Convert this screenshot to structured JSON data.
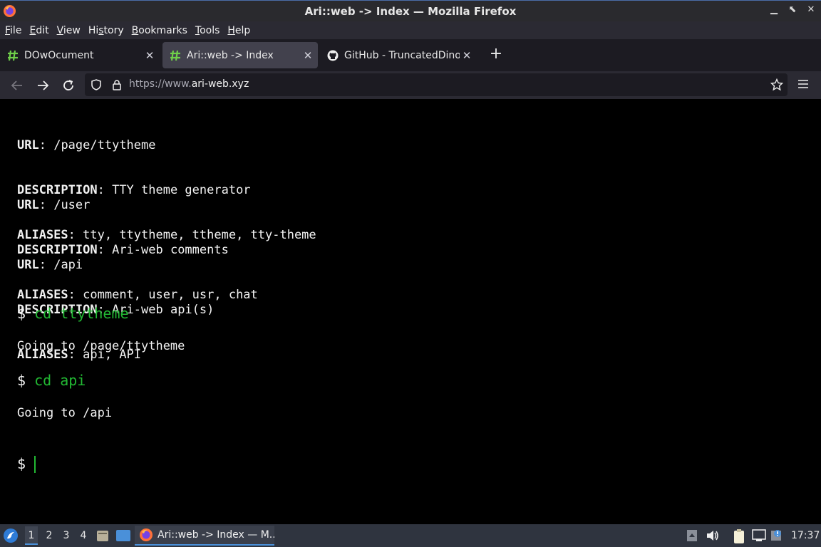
{
  "window": {
    "title": "Ari::web -> Index — Mozilla Firefox",
    "controls": [
      "minimize",
      "maximize",
      "close"
    ]
  },
  "menubar": {
    "items": [
      {
        "pre": "",
        "u": "F",
        "post": "ile"
      },
      {
        "pre": "",
        "u": "E",
        "post": "dit"
      },
      {
        "pre": "",
        "u": "V",
        "post": "iew"
      },
      {
        "pre": "Hi",
        "u": "s",
        "post": "tory"
      },
      {
        "pre": "",
        "u": "B",
        "post": "ookmarks"
      },
      {
        "pre": "",
        "u": "T",
        "post": "ools"
      },
      {
        "pre": "",
        "u": "H",
        "post": "elp"
      }
    ]
  },
  "tabs": [
    {
      "label": "DOwOcument",
      "icon": "hash-favicon-icon",
      "active": false
    },
    {
      "label": "Ari::web -> Index",
      "icon": "hash-favicon-icon",
      "active": true
    },
    {
      "label": "GitHub - TruncatedDinosour",
      "icon": "github-icon",
      "active": false
    }
  ],
  "navbar": {
    "url_prefix": "https://www.",
    "url_host": "ari-web.xyz"
  },
  "terminal": {
    "entries": [
      {
        "url": "/page/ttytheme",
        "description": "TTY theme generator",
        "aliases": "tty, ttytheme, ttheme, tty-theme"
      },
      {
        "url": "/user",
        "description": "Ari-web comments",
        "aliases": "comment, user, usr, chat"
      },
      {
        "url": "/api",
        "description": "Ari-web api(s)",
        "aliases": "api, API"
      }
    ],
    "labels": {
      "url": "URL",
      "description": "DESCRIPTION",
      "aliases": "ALIASES"
    },
    "prompt_symbol": "$",
    "commands": [
      {
        "cmd": "cd ttytheme",
        "output": "Going to /page/ttytheme"
      },
      {
        "cmd": "cd api",
        "output": "Going to /api"
      }
    ]
  },
  "taskbar": {
    "workspaces": [
      "1",
      "2",
      "3",
      "4"
    ],
    "active_workspace": "1",
    "task_label": "Ari::web -> Index — M...",
    "clock": "17:37"
  }
}
